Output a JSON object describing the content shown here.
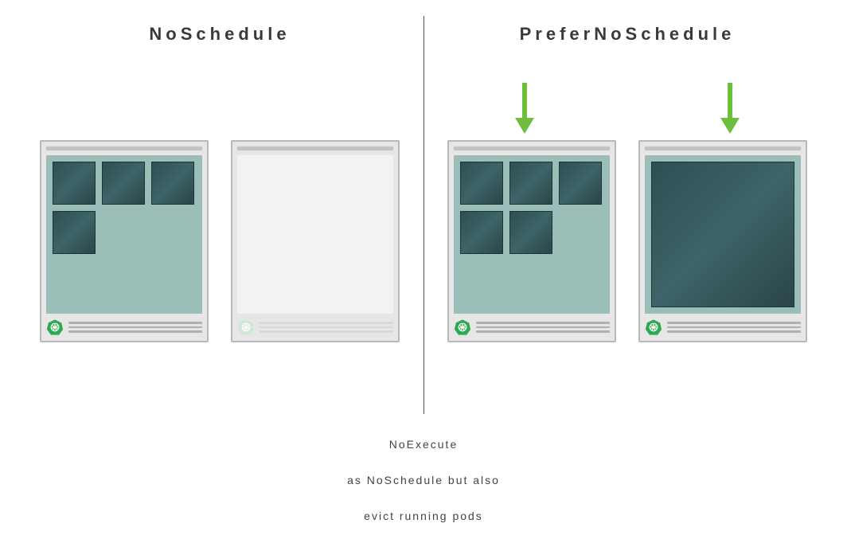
{
  "left": {
    "title": "NoSchedule",
    "nodes": [
      {
        "allocated": true,
        "podCount": 4,
        "bigPod": false,
        "iconActive": true
      },
      {
        "allocated": false,
        "podCount": 0,
        "bigPod": false,
        "iconActive": false
      }
    ]
  },
  "right": {
    "title": "PreferNoSchedule",
    "arrows": true,
    "nodes": [
      {
        "allocated": true,
        "podCount": 5,
        "bigPod": false,
        "iconActive": true
      },
      {
        "allocated": true,
        "podCount": 0,
        "bigPod": true,
        "iconActive": true
      }
    ]
  },
  "footer": {
    "line1": "NoExecute",
    "line2": "as NoSchedule but also",
    "line3": "evict running pods"
  },
  "colors": {
    "arrow": "#6fbf3f",
    "iconActive": "#2fa84f",
    "iconInactive": "#cfe8d5"
  }
}
